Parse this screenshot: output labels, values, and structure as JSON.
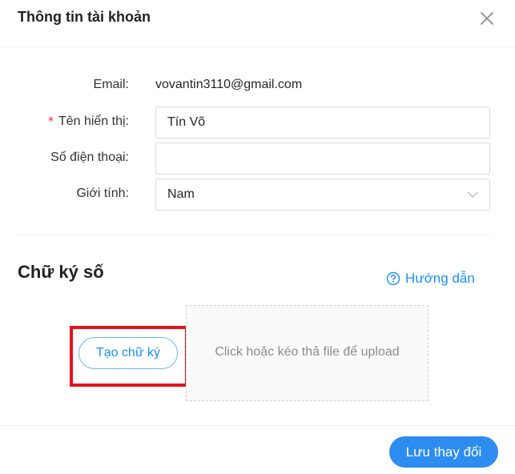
{
  "modal": {
    "title": "Thông tin tài khoản"
  },
  "form": {
    "email": {
      "label": "Email",
      "value": "vovantin3110@gmail.com"
    },
    "display_name": {
      "required_mark": "*",
      "label": "Tên hiển thị",
      "value": "Tín Võ"
    },
    "phone": {
      "label": "Số điện thoại",
      "value": ""
    },
    "gender": {
      "label": "Giới tính",
      "value": "Nam"
    },
    "colon": ":"
  },
  "signature": {
    "title": "Chữ ký số",
    "guide_label": "Hướng dẫn",
    "create_button": "Tạo chữ ký",
    "upload_hint": "Click hoặc kéo thả file để upload"
  },
  "footer": {
    "save_label": "Lưu thay đổi"
  },
  "icons": {
    "close": "close-icon",
    "help": "question-circle-icon",
    "dropdown": "chevron-down-icon"
  },
  "colors": {
    "accent": "#1890ff",
    "primary_button": "#2d8cf0",
    "required": "#f5222d",
    "highlight": "#e8131b"
  }
}
